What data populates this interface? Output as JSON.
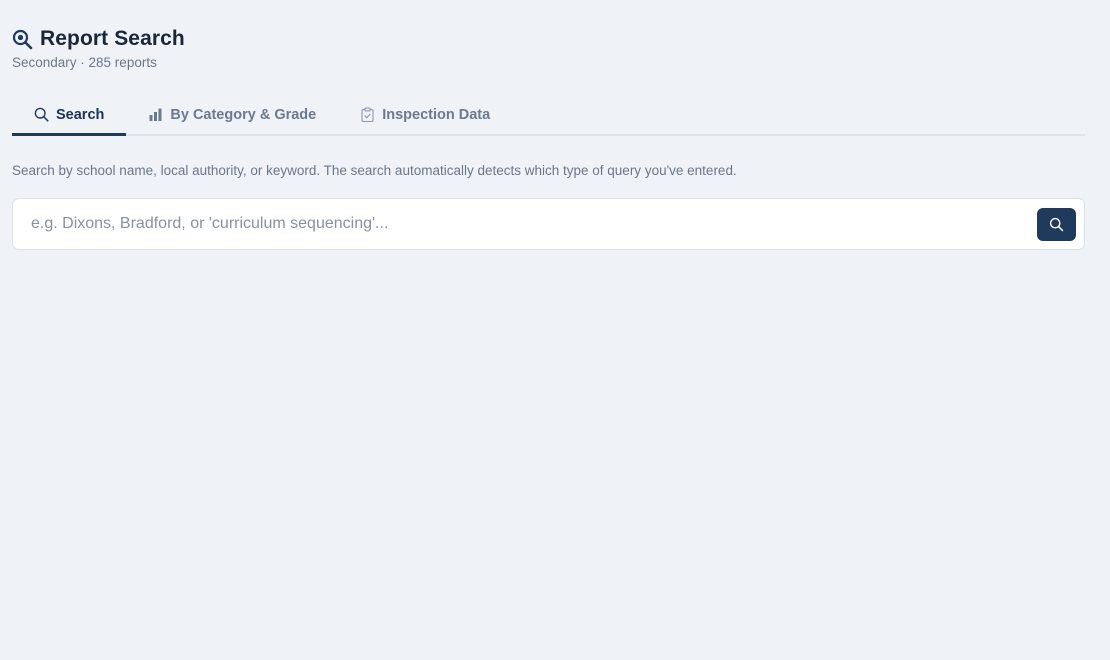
{
  "header": {
    "title": "Report Search",
    "subtitle": "Secondary · 285 reports"
  },
  "tabs": [
    {
      "label": "Search",
      "icon": "search-icon",
      "active": true
    },
    {
      "label": "By Category & Grade",
      "icon": "bar-chart-icon",
      "active": false
    },
    {
      "label": "Inspection Data",
      "icon": "clipboard-check-icon",
      "active": false
    }
  ],
  "search": {
    "description": "Search by school name, local authority, or keyword. The search automatically detects which type of query you've entered.",
    "placeholder": "e.g. Dixons, Bradford, or 'curriculum sequencing'...",
    "value": "",
    "button_icon": "search-icon"
  },
  "colors": {
    "background": "#eff3f8",
    "accent": "#1f3a5c",
    "muted_text": "#6a7789",
    "title_text": "#1b2638"
  }
}
